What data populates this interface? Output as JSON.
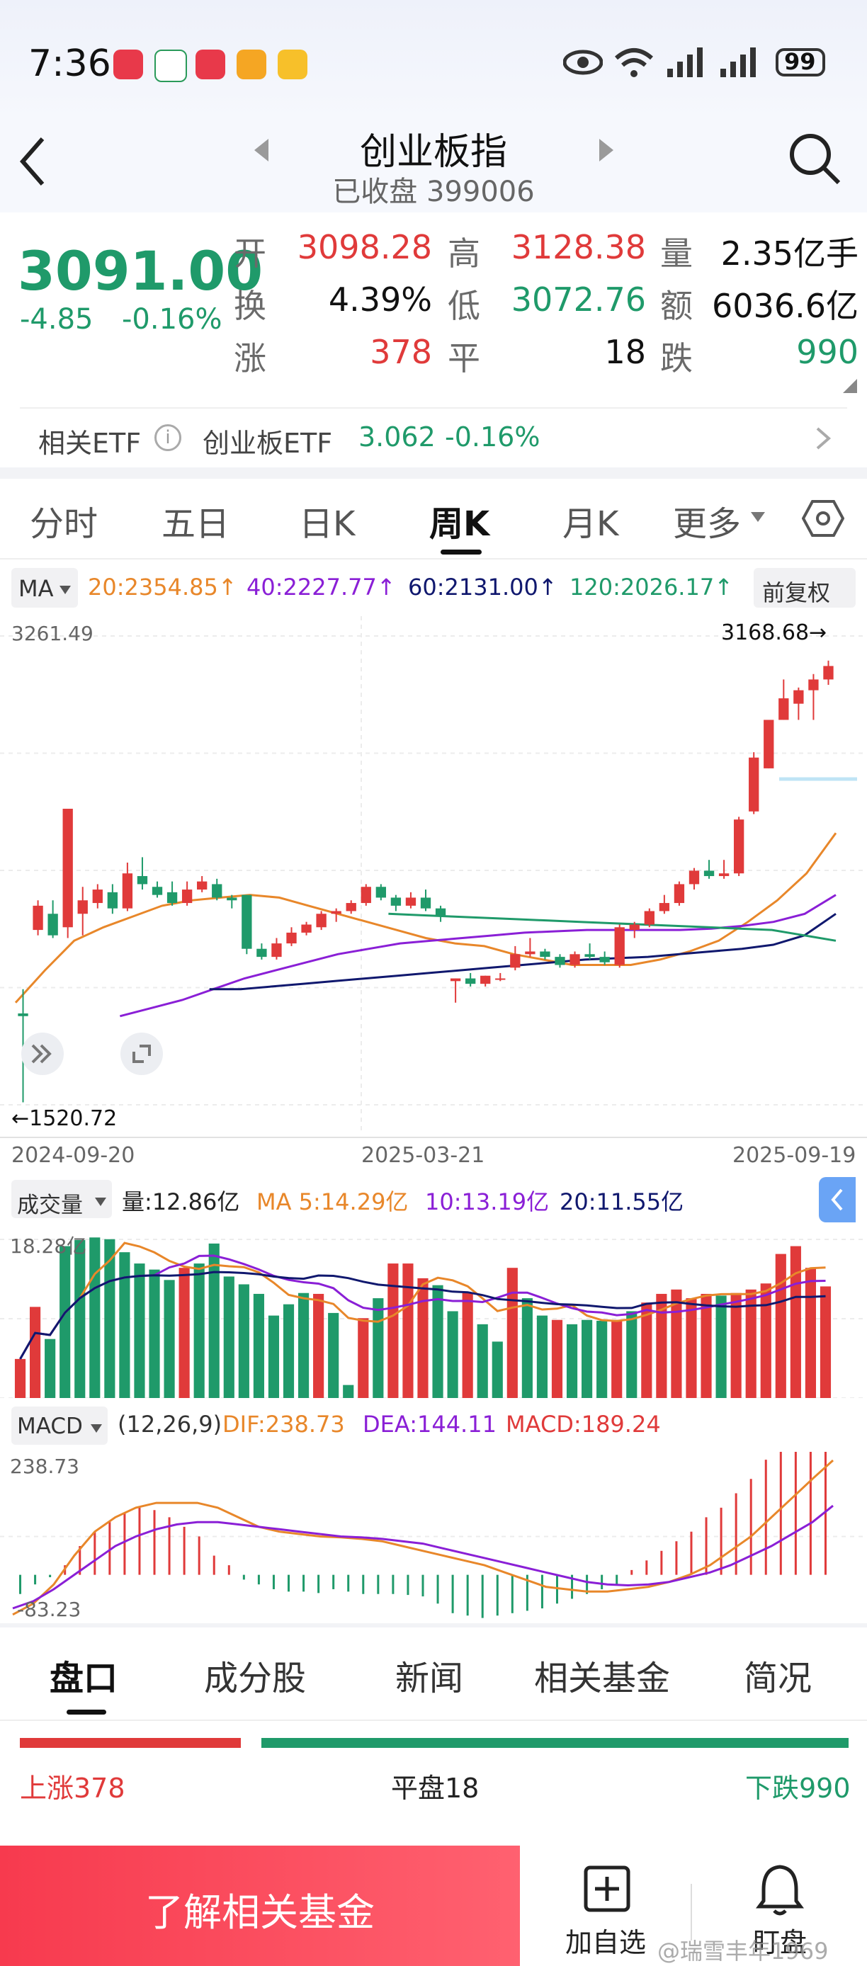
{
  "status_bar": {
    "time": "7:36",
    "battery": "99"
  },
  "header": {
    "title": "创业板指",
    "subtitle": "已收盘 399006"
  },
  "quote": {
    "price": "3091.00",
    "change": "-4.85",
    "change_pct": "-0.16%",
    "open_label": "开",
    "open": "3098.28",
    "high_label": "高",
    "high": "3128.38",
    "volume_label": "量",
    "volume": "2.35亿手",
    "turnover_label": "换",
    "turnover": "4.39%",
    "low_label": "低",
    "low": "3072.76",
    "amount_label": "额",
    "amount": "6036.6亿",
    "up_label": "涨",
    "up": "378",
    "flat_label": "平",
    "flat": "18",
    "down_label": "跌",
    "down": "990"
  },
  "etf": {
    "label": "相关ETF",
    "name": "创业板ETF",
    "price": "3.062",
    "change": "-0.16%"
  },
  "period_tabs": [
    "分时",
    "五日",
    "日K",
    "周K",
    "月K",
    "更多"
  ],
  "ma_bar": {
    "selector": "MA",
    "ma20": "20:2354.85↑",
    "ma40": "40:2227.77↑",
    "ma60": "60:2131.00↑",
    "ma120": "120:2026.17↑",
    "adjust": "前复权"
  },
  "kline": {
    "max_label": "3261.49",
    "high_marker": "3168.68→",
    "low_marker": "←1520.72",
    "date_start": "2024-09-20",
    "date_mid": "2025-03-21",
    "date_end": "2025-09-19"
  },
  "volume_bar": {
    "selector": "成交量",
    "vol": "量:12.86亿",
    "ma5": "MA 5:14.29亿",
    "ma10": "10:13.19亿",
    "ma20": "20:11.55亿",
    "max_label": "18.28亿"
  },
  "macd_bar": {
    "selector": "MACD",
    "params": "(12,26,9)",
    "dif": "DIF:238.73",
    "dea": "DEA:144.11",
    "macd": "MACD:189.24",
    "max_label": "238.73",
    "min_label": "-83.23"
  },
  "bottom_tabs": [
    "盘口",
    "成分股",
    "新闻",
    "相关基金",
    "简况"
  ],
  "breadth": {
    "up": "上涨378",
    "flat": "平盘18",
    "down": "下跌990",
    "up_count": 378,
    "flat_count": 18,
    "down_count": 990
  },
  "footer": {
    "cta": "了解相关基金",
    "add_watch": "加自选",
    "watch": "盯盘",
    "watermark": "@瑞雪丰年1969"
  },
  "colors": {
    "up": "#e03a3a",
    "down": "#1f9a6a",
    "ma20": "#e8872a",
    "ma40": "#8a1fd6",
    "ma60": "#10186e",
    "ma120": "#1f9a6a"
  },
  "chart_data": {
    "type": "candlestick",
    "y_range": [
      1520.72,
      3261.49
    ],
    "candles_ohlc": [
      [
        1860,
        1850,
        1950,
        1530
      ],
      [
        2170,
        2260,
        2280,
        2150
      ],
      [
        2230,
        2150,
        2280,
        2140
      ],
      [
        2180,
        2620,
        2620,
        2140
      ],
      [
        2230,
        2280,
        2330,
        2150
      ],
      [
        2270,
        2320,
        2340,
        2250
      ],
      [
        2310,
        2250,
        2340,
        2230
      ],
      [
        2250,
        2380,
        2420,
        2240
      ],
      [
        2370,
        2340,
        2440,
        2320
      ],
      [
        2330,
        2300,
        2350,
        2290
      ],
      [
        2310,
        2270,
        2350,
        2260
      ],
      [
        2270,
        2320,
        2350,
        2260
      ],
      [
        2320,
        2350,
        2370,
        2310
      ],
      [
        2340,
        2290,
        2360,
        2280
      ],
      [
        2290,
        2280,
        2300,
        2250
      ],
      [
        2300,
        2100,
        2300,
        2080
      ],
      [
        2100,
        2070,
        2120,
        2060
      ],
      [
        2070,
        2120,
        2140,
        2060
      ],
      [
        2120,
        2160,
        2180,
        2110
      ],
      [
        2160,
        2190,
        2200,
        2150
      ],
      [
        2180,
        2230,
        2240,
        2170
      ],
      [
        2230,
        2240,
        2250,
        2200
      ],
      [
        2240,
        2270,
        2280,
        2230
      ],
      [
        2270,
        2330,
        2340,
        2260
      ],
      [
        2330,
        2290,
        2340,
        2280
      ],
      [
        2290,
        2260,
        2300,
        2240
      ],
      [
        2260,
        2290,
        2310,
        2250
      ],
      [
        2290,
        2250,
        2320,
        2240
      ],
      [
        2250,
        2220,
        2260,
        2200
      ],
      [
        1980,
        1990,
        1990,
        1900
      ],
      [
        1990,
        1970,
        2010,
        1960
      ],
      [
        1970,
        2000,
        2000,
        1960
      ],
      [
        1990,
        1990,
        2010,
        1980
      ],
      [
        2030,
        2080,
        2110,
        2020
      ],
      [
        2080,
        2090,
        2140,
        2070
      ],
      [
        2090,
        2070,
        2100,
        2060
      ],
      [
        2070,
        2040,
        2080,
        2030
      ],
      [
        2040,
        2080,
        2090,
        2030
      ],
      [
        2080,
        2070,
        2120,
        2060
      ],
      [
        2070,
        2050,
        2090,
        2040
      ],
      [
        2040,
        2180,
        2190,
        2030
      ],
      [
        2170,
        2190,
        2200,
        2140
      ],
      [
        2190,
        2240,
        2250,
        2180
      ],
      [
        2240,
        2270,
        2300,
        2230
      ],
      [
        2270,
        2340,
        2350,
        2260
      ],
      [
        2340,
        2390,
        2400,
        2320
      ],
      [
        2390,
        2370,
        2430,
        2360
      ],
      [
        2370,
        2380,
        2430,
        2360
      ],
      [
        2380,
        2580,
        2590,
        2370
      ],
      [
        2610,
        2810,
        2830,
        2600
      ],
      [
        2770,
        2950,
        2950,
        2770
      ],
      [
        2950,
        3030,
        3100,
        2950
      ],
      [
        3010,
        3060,
        3070,
        2950
      ],
      [
        3060,
        3100,
        3120,
        2950
      ],
      [
        3100,
        3150,
        3170,
        3080
      ]
    ],
    "ma_lines": [
      {
        "name": "20",
        "values": [
          1900,
          2020,
          2130,
          2180,
          2220,
          2260,
          2280,
          2290,
          2300,
          2290,
          2260,
          2230,
          2200,
          2170,
          2140,
          2120,
          2110,
          2080,
          2060,
          2040,
          2040,
          2040,
          2060,
          2090,
          2130,
          2200,
          2280,
          2380,
          2530
        ]
      },
      {
        "name": "40",
        "values": [
          1850,
          1880,
          1910,
          1950,
          1990,
          2020,
          2050,
          2080,
          2100,
          2120,
          2130,
          2140,
          2150,
          2160,
          2165,
          2170,
          2170,
          2170,
          2170,
          2175,
          2185,
          2200,
          2230,
          2300
        ]
      },
      {
        "name": "60",
        "values": [
          1950,
          1950,
          1960,
          1970,
          1980,
          1990,
          2000,
          2010,
          2020,
          2030,
          2040,
          2050,
          2060,
          2065,
          2070,
          2080,
          2090,
          2100,
          2115,
          2150,
          2230
        ]
      },
      {
        "name": "120",
        "values": [
          2230,
          2225,
          2220,
          2215,
          2210,
          2205,
          2200,
          2195,
          2190,
          2185,
          2180,
          2175,
          2170,
          2150,
          2130
        ]
      }
    ],
    "volume_yi": [
      4.5,
      10.5,
      6.8,
      17.5,
      18.2,
      18.5,
      18.3,
      16.8,
      15.5,
      14.8,
      13.6,
      15.0,
      15.5,
      17.8,
      14.0,
      13.1,
      12.0,
      9.5,
      10.8,
      12.1,
      12.0,
      9.8,
      1.5,
      9.2,
      11.5,
      15.5,
      15.5,
      13.8,
      13.0,
      10.0,
      12.1,
      8.5,
      6.5,
      15.0,
      11.5,
      9.5,
      9.0,
      8.5,
      9.0,
      8.9,
      9.0,
      10.0,
      11.0,
      12.0,
      12.5,
      11.5,
      12.0,
      11.8,
      12.1,
      12.5,
      13.2,
      16.6,
      17.5,
      15.0,
      12.86
    ],
    "volume_up": [
      1,
      1,
      0,
      0,
      0,
      0,
      0,
      0,
      0,
      0,
      0,
      1,
      0,
      0,
      0,
      0,
      0,
      0,
      0,
      0,
      1,
      0,
      0,
      1,
      0,
      1,
      1,
      1,
      0,
      0,
      1,
      0,
      0,
      1,
      0,
      0,
      1,
      0,
      0,
      0,
      1,
      0,
      1,
      1,
      1,
      1,
      1,
      0,
      1,
      1,
      1,
      1,
      1,
      1,
      1
    ],
    "macd_hist": [
      -40,
      -20,
      -5,
      20,
      60,
      90,
      110,
      130,
      140,
      135,
      120,
      100,
      80,
      40,
      20,
      -10,
      -20,
      -30,
      -35,
      -35,
      -38,
      -30,
      -35,
      -40,
      -40,
      -40,
      -42,
      -45,
      -60,
      -80,
      -85,
      -90,
      -85,
      -80,
      -75,
      -70,
      -60,
      -50,
      -40,
      -30,
      -20,
      10,
      30,
      50,
      70,
      90,
      120,
      140,
      170,
      200,
      240,
      260,
      280,
      300,
      310
    ],
    "dif": [
      -83,
      -60,
      -20,
      40,
      90,
      120,
      140,
      150,
      150,
      150,
      140,
      120,
      100,
      90,
      85,
      80,
      78,
      75,
      70,
      60,
      50,
      40,
      30,
      20,
      5,
      -10,
      -25,
      -30,
      -35,
      -35,
      -30,
      -25,
      -15,
      0,
      20,
      50,
      80,
      120,
      160,
      200,
      238.73
    ],
    "dea": [
      -70,
      -55,
      -30,
      0,
      30,
      60,
      80,
      95,
      105,
      110,
      110,
      105,
      100,
      95,
      90,
      85,
      80,
      78,
      75,
      70,
      65,
      55,
      45,
      35,
      25,
      15,
      5,
      -5,
      -15,
      -20,
      -22,
      -20,
      -15,
      -5,
      5,
      20,
      40,
      60,
      85,
      110,
      144.11
    ]
  }
}
